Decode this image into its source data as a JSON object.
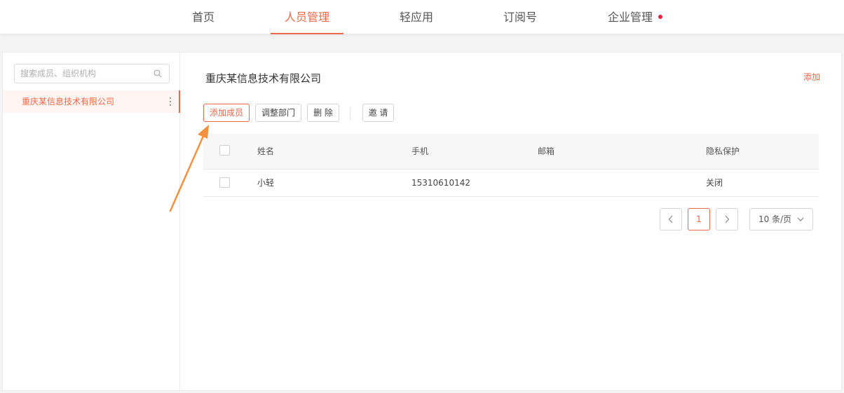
{
  "nav": {
    "items": [
      {
        "label": "首页",
        "active": false
      },
      {
        "label": "人员管理",
        "active": true
      },
      {
        "label": "轻应用",
        "active": false
      },
      {
        "label": "订阅号",
        "active": false
      },
      {
        "label": "企业管理",
        "active": false,
        "dot": true
      }
    ]
  },
  "sidebar": {
    "search_placeholder": "搜索成员、组织机构",
    "org_name": "重庆某信息技术有限公司"
  },
  "content": {
    "title": "重庆某信息技术有限公司",
    "add_link": "添加",
    "toolbar": {
      "add_member": "添加成员",
      "adjust_dept": "调整部门",
      "delete": "删 除",
      "invite": "邀 请"
    },
    "table": {
      "headers": {
        "name": "姓名",
        "phone": "手机",
        "email": "邮箱",
        "privacy": "隐私保护"
      },
      "rows": [
        {
          "name": "小轻",
          "phone": "15310610142",
          "email": "",
          "privacy": "关闭"
        }
      ]
    },
    "pagination": {
      "current_page": "1",
      "page_size": "10 条/页"
    }
  },
  "colors": {
    "accent": "#f0674a",
    "dot": "#e8213f",
    "annotation_arrow": "#f5913e"
  }
}
